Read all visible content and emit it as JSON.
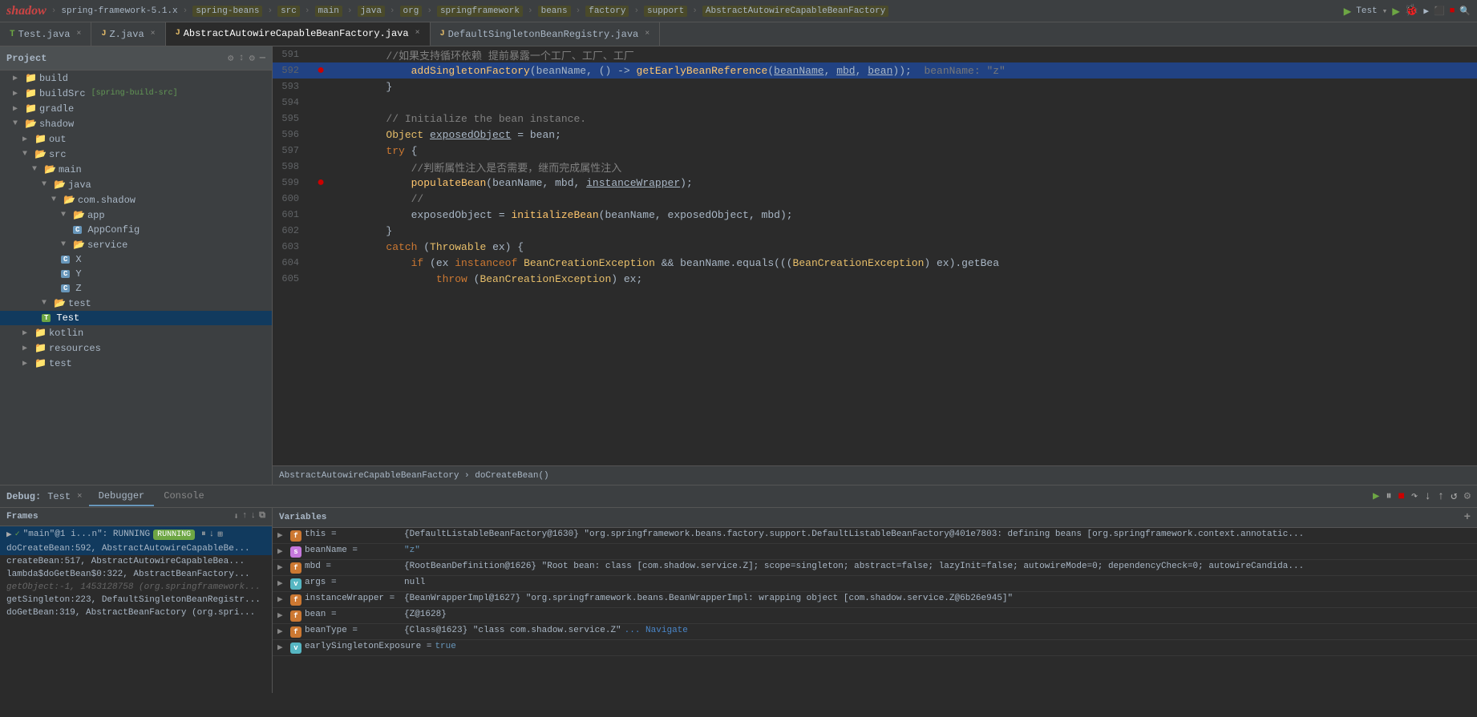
{
  "topbar": {
    "project": "spring-framework-5.1.x",
    "breadcrumbs": [
      "spring-beans",
      "src",
      "main",
      "java",
      "org",
      "springframework",
      "beans",
      "factory",
      "support",
      "AbstractAutowireCapableBeanFactory"
    ],
    "run_config": "Test",
    "title": "shadow"
  },
  "tabs": [
    {
      "id": "test-java",
      "label": "Test.java",
      "type": "test",
      "active": false,
      "modified": false
    },
    {
      "id": "z-java",
      "label": "Z.java",
      "type": "java",
      "active": false,
      "modified": false
    },
    {
      "id": "abstract-factory",
      "label": "AbstractAutowireCapableBeanFactory.java",
      "type": "java",
      "active": true,
      "modified": false
    },
    {
      "id": "default-singleton",
      "label": "DefaultSingletonBeanRegistry.java",
      "type": "java",
      "active": false,
      "modified": false
    }
  ],
  "sidebar": {
    "title": "Project",
    "tree": [
      {
        "id": "build",
        "label": "build",
        "type": "folder",
        "indent": 1,
        "expanded": false
      },
      {
        "id": "buildSrc",
        "label": "buildSrc",
        "tag": "[spring-build-src]",
        "type": "folder",
        "indent": 1,
        "expanded": false
      },
      {
        "id": "gradle",
        "label": "gradle",
        "type": "folder",
        "indent": 1,
        "expanded": false
      },
      {
        "id": "shadow",
        "label": "shadow",
        "type": "folder",
        "indent": 1,
        "expanded": true
      },
      {
        "id": "out",
        "label": "out",
        "type": "folder",
        "indent": 2,
        "expanded": false
      },
      {
        "id": "src",
        "label": "src",
        "type": "folder",
        "indent": 2,
        "expanded": true
      },
      {
        "id": "main",
        "label": "main",
        "type": "folder",
        "indent": 3,
        "expanded": true
      },
      {
        "id": "java",
        "label": "java",
        "type": "folder",
        "indent": 4,
        "expanded": true
      },
      {
        "id": "com-shadow",
        "label": "com.shadow",
        "type": "folder",
        "indent": 5,
        "expanded": true
      },
      {
        "id": "app",
        "label": "app",
        "type": "folder",
        "indent": 6,
        "expanded": true
      },
      {
        "id": "AppConfig",
        "label": "AppConfig",
        "type": "class",
        "indent": 7
      },
      {
        "id": "service",
        "label": "service",
        "type": "folder",
        "indent": 6,
        "expanded": true
      },
      {
        "id": "X",
        "label": "X",
        "type": "class",
        "indent": 7
      },
      {
        "id": "Y",
        "label": "Y",
        "type": "class",
        "indent": 7
      },
      {
        "id": "Z",
        "label": "Z",
        "type": "class",
        "indent": 7
      },
      {
        "id": "test",
        "label": "test",
        "type": "folder",
        "indent": 4,
        "expanded": true
      },
      {
        "id": "Test",
        "label": "Test",
        "type": "test-class",
        "indent": 5,
        "selected": true
      },
      {
        "id": "kotlin",
        "label": "kotlin",
        "type": "folder",
        "indent": 2,
        "expanded": false
      },
      {
        "id": "resources",
        "label": "resources",
        "type": "folder",
        "indent": 2,
        "expanded": false
      },
      {
        "id": "test-folder",
        "label": "test",
        "type": "folder",
        "indent": 2,
        "expanded": false
      }
    ]
  },
  "editor": {
    "lines": [
      {
        "num": 591,
        "breakpoint": false,
        "content": "//如果支持循环依赖 提前暴露一个工厂、工厂、工厂",
        "highlighted": false,
        "type": "comment"
      },
      {
        "num": 592,
        "breakpoint": true,
        "content": "            addSingletonFactory(beanName, () -> getEarlyBeanReference(beanName, mbd, bean));",
        "highlighted": true,
        "hint": "beanName: \"z\"",
        "type": "code"
      },
      {
        "num": 593,
        "breakpoint": false,
        "content": "        }",
        "highlighted": false,
        "type": "code"
      },
      {
        "num": 594,
        "breakpoint": false,
        "content": "",
        "highlighted": false,
        "type": "code"
      },
      {
        "num": 595,
        "breakpoint": false,
        "content": "        // Initialize the bean instance.",
        "highlighted": false,
        "type": "comment"
      },
      {
        "num": 596,
        "breakpoint": false,
        "content": "        Object exposedObject = bean;",
        "highlighted": false,
        "type": "code"
      },
      {
        "num": 597,
        "breakpoint": false,
        "content": "        try {",
        "highlighted": false,
        "type": "code"
      },
      {
        "num": 598,
        "breakpoint": false,
        "content": "            //判断属性注入是否需要，继而完成属性注入",
        "highlighted": false,
        "type": "comment"
      },
      {
        "num": 599,
        "breakpoint": true,
        "content": "            populateBean(beanName, mbd, instanceWrapper);",
        "highlighted": false,
        "type": "code"
      },
      {
        "num": 600,
        "breakpoint": false,
        "content": "            //",
        "highlighted": false,
        "type": "comment"
      },
      {
        "num": 601,
        "breakpoint": false,
        "content": "            exposedObject = initializeBean(beanName, exposedObject, mbd);",
        "highlighted": false,
        "type": "code"
      },
      {
        "num": 602,
        "breakpoint": false,
        "content": "        }",
        "highlighted": false,
        "type": "code"
      },
      {
        "num": 603,
        "breakpoint": false,
        "content": "        catch (Throwable ex) {",
        "highlighted": false,
        "type": "code"
      },
      {
        "num": 604,
        "breakpoint": false,
        "content": "            if (ex instanceof BeanCreationException && beanName.equals(((BeanCreationException) ex).getBea",
        "highlighted": false,
        "type": "code"
      },
      {
        "num": 605,
        "breakpoint": false,
        "content": "                throw (BeanCreationException) ex;",
        "highlighted": false,
        "type": "code"
      }
    ],
    "breadcrumb": "AbstractAutowireCapableBeanFactory › doCreateBean()"
  },
  "debug": {
    "title": "Debug:",
    "session_name": "Test",
    "tabs": [
      "Debugger",
      "Console"
    ],
    "active_tab": "Debugger",
    "frames_section": "Frames",
    "thread": {
      "label": "\"main\"@1 i...n\": RUNNING",
      "status": "RUNNING"
    },
    "frames": [
      {
        "id": "f1",
        "label": "doCreateBean:592, AbstractAutowireCapableBe...",
        "active": true
      },
      {
        "id": "f2",
        "label": "createBean:517, AbstractAutowireCapableBea..."
      },
      {
        "id": "f3",
        "label": "lambda$doGetBean$0:322, AbstractBeanFactory..."
      },
      {
        "id": "f4",
        "label": "getObject:-1, 1453128758 (org.springframework..."
      },
      {
        "id": "f5",
        "label": "getSingleton:223, DefaultSingletonBeanRegistr..."
      },
      {
        "id": "f6",
        "label": "doGetBean:319, AbstractBeanFactory (org.spri..."
      }
    ],
    "variables_section": "Variables",
    "variables": [
      {
        "id": "this",
        "name": "this",
        "type": "orange",
        "type_label": "f",
        "value": "= {DefaultListableBeanFactory@1630} \"org.springframework.beans.factory.support.DefaultListableBeanFactory@401e7803: defining beans [org.springframework.context.annotatic..."
      },
      {
        "id": "beanName",
        "name": "beanName",
        "type": "pink",
        "type_label": "s",
        "value": "= \"z\""
      },
      {
        "id": "mbd",
        "name": "mbd",
        "type": "orange",
        "type_label": "f",
        "value": "= {RootBeanDefinition@1626} \"Root bean: class [com.shadow.service.Z]; scope=singleton; abstract=false; lazyInit=false; autowireMode=0; dependencyCheck=0; autowireCandida..."
      },
      {
        "id": "args",
        "name": "args",
        "type": "teal",
        "type_label": "v",
        "value": "= null"
      },
      {
        "id": "instanceWrapper",
        "name": "instanceWrapper",
        "type": "orange",
        "type_label": "f",
        "value": "= {BeanWrapperImpl@1627} \"org.springframework.beans.BeanWrapperImpl: wrapping object [com.shadow.service.Z@6b26e945]\""
      },
      {
        "id": "bean",
        "name": "bean",
        "type": "orange",
        "type_label": "f",
        "value": "= {Z@1628}"
      },
      {
        "id": "beanType",
        "name": "beanType",
        "type": "orange",
        "type_label": "f",
        "value": "= {Class@1623} \"class com.shadow.service.Z\"",
        "navigate": "Navigate"
      },
      {
        "id": "earlySingletonExposure",
        "name": "earlySingletonExposure",
        "type": "teal",
        "type_label": "v",
        "value": "= true"
      }
    ]
  }
}
